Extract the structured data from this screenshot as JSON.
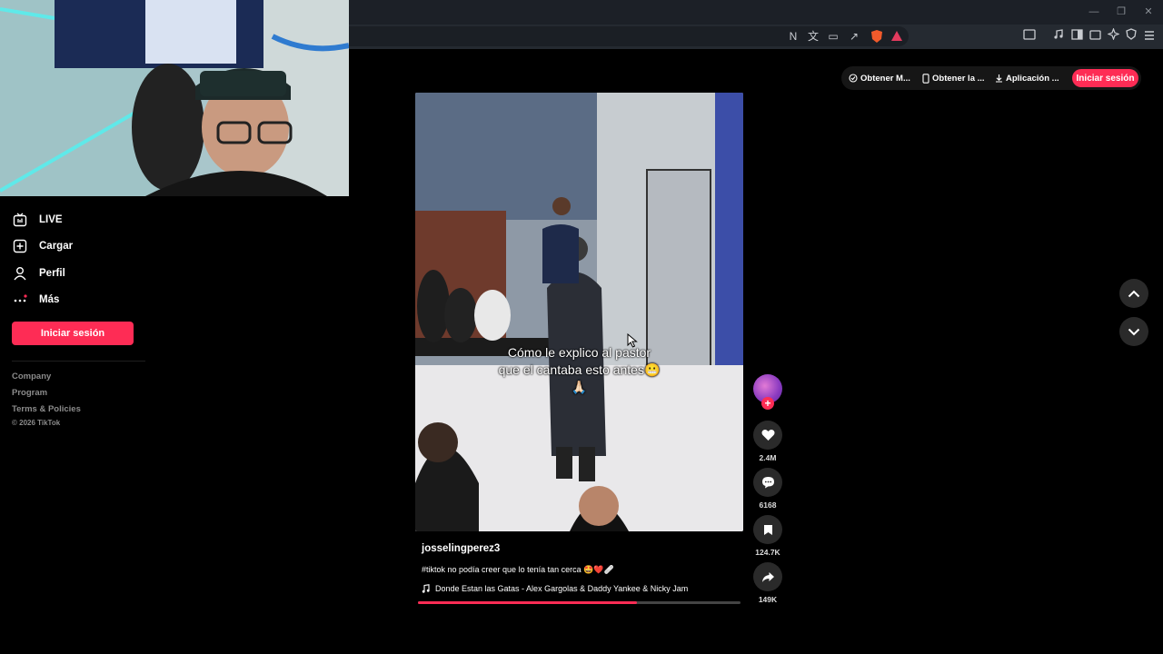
{
  "browser": {
    "window_controls": [
      "—",
      "❐",
      "✕"
    ],
    "toolbar_icons": [
      "N",
      "文",
      "▭",
      "↗"
    ]
  },
  "sidebar": {
    "items": [
      {
        "label": "LIVE",
        "icon": "live-icon"
      },
      {
        "label": "Cargar",
        "icon": "upload-icon"
      },
      {
        "label": "Perfil",
        "icon": "profile-icon"
      },
      {
        "label": "Más",
        "icon": "more-icon"
      }
    ],
    "login_label": "Iniciar sesión",
    "footer_links": [
      "Company",
      "Program",
      "Terms & Policies"
    ],
    "copyright": "© 2026 TikTok"
  },
  "topbar": {
    "pills": [
      "Obtener M...",
      "Obtener la ...",
      "Aplicación ..."
    ],
    "login_label": "Iniciar sesión"
  },
  "video": {
    "caption_line1": "Cómo le explico al pastor",
    "caption_line2": "que el cantaba esto antes😬",
    "caption_line3": "🙏🏻",
    "author": "josselingperez3",
    "description": "#tiktok no podía creer que lo tenía tan cerca 🤩❤️🩹",
    "music": "Donde Estan las Gatas - Alex Gargolas & Daddy Yankee & Nicky Jam",
    "progress": 0.68
  },
  "actions": {
    "likes": "2.4M",
    "comments": "6168",
    "saves": "124.7K",
    "shares": "149K"
  },
  "colors": {
    "accent": "#fe2c55",
    "background": "#000000"
  }
}
